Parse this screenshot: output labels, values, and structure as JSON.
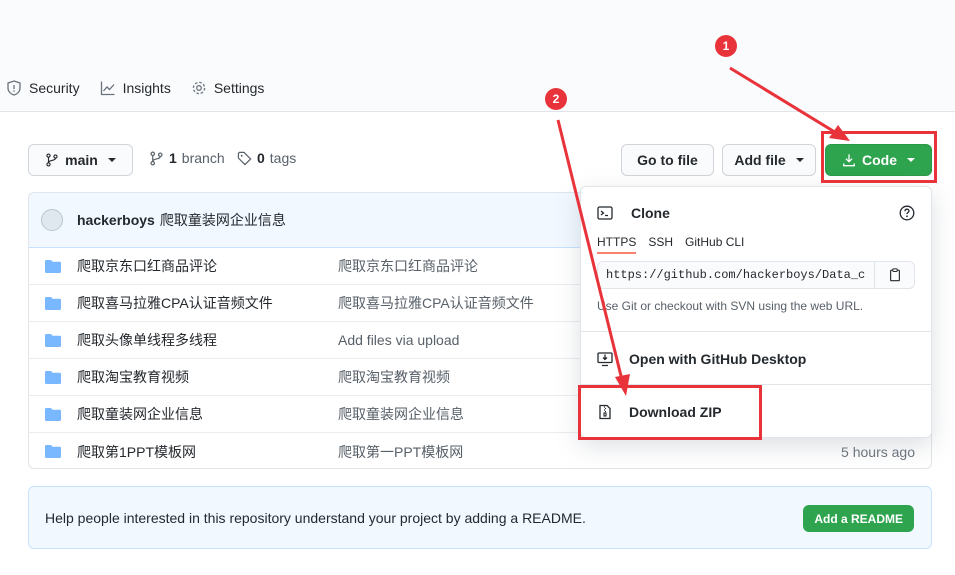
{
  "repo_nav": {
    "tabs": [
      {
        "label": "Security",
        "icon": "shield-icon"
      },
      {
        "label": "Insights",
        "icon": "graph-icon"
      },
      {
        "label": "Settings",
        "icon": "gear-icon"
      }
    ]
  },
  "toolbar": {
    "branch_label": "main",
    "branch_count": "1",
    "branch_word": "branch",
    "tag_count": "0",
    "tag_word": "tags",
    "goto_file_label": "Go to file",
    "add_file_label": "Add file",
    "code_label": "Code"
  },
  "latest_commit": {
    "user": "hackerboys",
    "message": "爬取童装网企业信息"
  },
  "files": [
    {
      "name": "爬取京东口红商品评论",
      "commit": "爬取京东口红商品评论",
      "age": ""
    },
    {
      "name": "爬取喜马拉雅CPA认证音频文件",
      "commit": "爬取喜马拉雅CPA认证音频文件",
      "age": ""
    },
    {
      "name": "爬取头像单线程多线程",
      "commit": "Add files via upload",
      "age": ""
    },
    {
      "name": "爬取淘宝教育视频",
      "commit": "爬取淘宝教育视频",
      "age": ""
    },
    {
      "name": "爬取童装网企业信息",
      "commit": "爬取童装网企业信息",
      "age": ""
    },
    {
      "name": "爬取第1PPT模板网",
      "commit": "爬取第一PPT模板网",
      "age": "5 hours ago"
    }
  ],
  "readme_banner": {
    "text": "Help people interested in this repository understand your project by adding a README.",
    "button_label": "Add a README"
  },
  "code_dropdown": {
    "clone_title": "Clone",
    "tabs": [
      "HTTPS",
      "SSH",
      "GitHub CLI"
    ],
    "active_tab": "HTTPS",
    "clone_url": "https://github.com/hackerboys/Data_col",
    "hint": "Use Git or checkout with SVN using the web URL.",
    "desktop_label": "Open with GitHub Desktop",
    "zip_label": "Download ZIP"
  },
  "annotations": {
    "badge_1": "1",
    "badge_2": "2",
    "color": "#e8333a"
  },
  "colors": {
    "primary_green": "#2ea44f",
    "link_blue": "#54aeff",
    "folder_blue": "#79b8ff"
  }
}
